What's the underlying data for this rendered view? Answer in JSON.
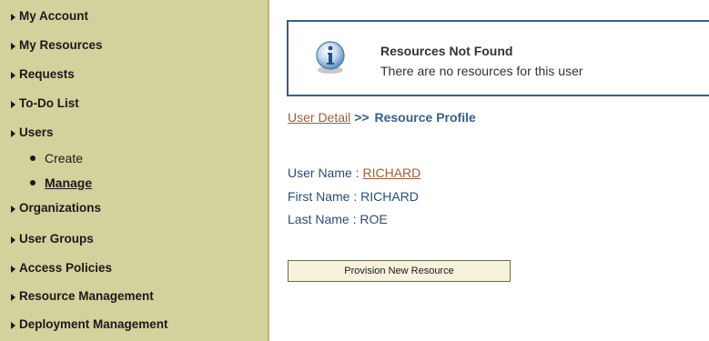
{
  "sidebar": {
    "items": [
      {
        "label": "My Account"
      },
      {
        "label": "My Resources"
      },
      {
        "label": "Requests"
      },
      {
        "label": "To-Do List"
      },
      {
        "label": "Users"
      },
      {
        "label": "Organizations"
      },
      {
        "label": "User Groups"
      },
      {
        "label": "Access Policies"
      },
      {
        "label": "Resource Management"
      },
      {
        "label": "Deployment Management"
      }
    ],
    "users_sub": [
      {
        "label": "Create"
      },
      {
        "label": "Manage"
      }
    ]
  },
  "message": {
    "icon": "info-icon",
    "title": "Resources Not Found",
    "text": "There are no resources for this user"
  },
  "breadcrumb": {
    "link": "User Detail",
    "separator": ">>",
    "current": "Resource Profile"
  },
  "user": {
    "username_label": "User Name : ",
    "username": "RICHARD",
    "first_name_label": "First Name : ",
    "first_name": "RICHARD",
    "last_name_label": "Last Name : ",
    "last_name": "ROE"
  },
  "actions": {
    "provision_label": "Provision New Resource"
  },
  "colors": {
    "sidebar_bg": "#d3d29d",
    "link": "#9b5f3a",
    "text_blue": "#2d4c74",
    "box_border": "#3e5e7e"
  }
}
